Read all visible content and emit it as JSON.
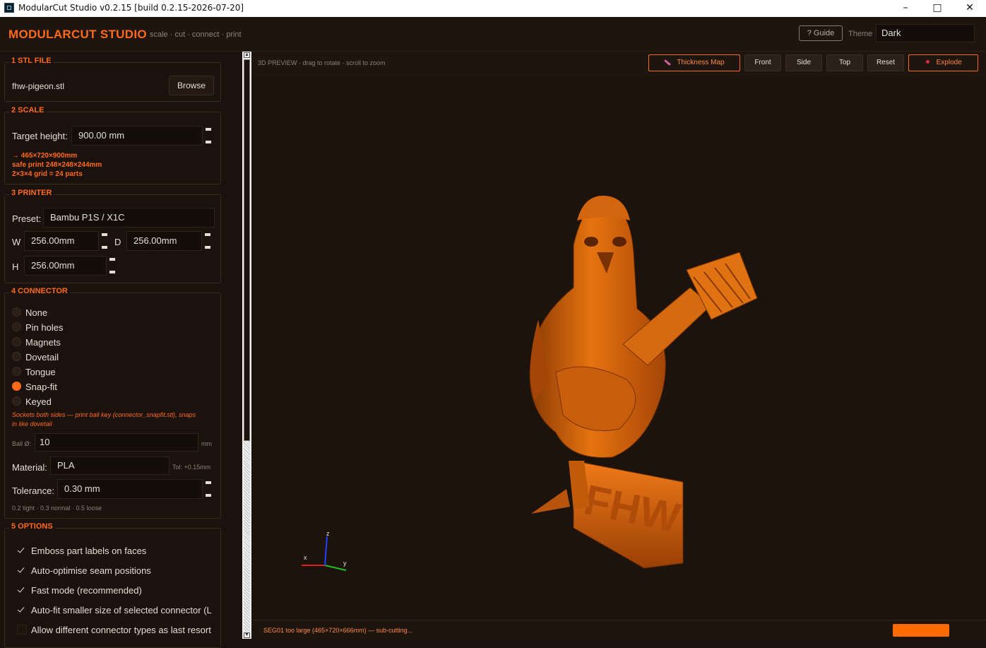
{
  "window": {
    "title": "ModularCut Studio  v0.2.15  [build 0.2.15-2026-07-20]",
    "minimize": "–",
    "maximize": "□",
    "close": "✕"
  },
  "header": {
    "brand": "MODULARCUT STUDIO",
    "tagline": "scale · cut · connect · print",
    "guide": "? Guide",
    "theme_label": "Theme",
    "theme_value": "Dark"
  },
  "stl": {
    "title": "1  STL FILE",
    "filename": "fhw-pigeon.stl",
    "browse": "Browse"
  },
  "scale": {
    "title": "2  SCALE",
    "target_label": "Target height:",
    "target_value": "900.00 mm",
    "info1": "→ 465×720×900mm",
    "info2": "safe print 248×248×244mm",
    "info3": "2×3×4 grid = 24 parts"
  },
  "printer": {
    "title": "3  PRINTER",
    "preset_label": "Preset:",
    "preset_value": "Bambu P1S / X1C",
    "w_label": "W",
    "w_value": "256.00mm",
    "d_label": "D",
    "d_value": "256.00mm",
    "h_label": "H",
    "h_value": "256.00mm"
  },
  "connector": {
    "title": "4  CONNECTOR",
    "options": [
      "None",
      "Pin holes",
      "Magnets",
      "Dovetail",
      "Tongue",
      "Snap-fit",
      "Keyed"
    ],
    "selected": "Snap-fit",
    "desc1": "Sockets both sides — print ball key (connector_snapfit.stl), snaps",
    "desc2": "in like dovetail",
    "ball_label": "Ball Ø:",
    "ball_value": "10",
    "ball_unit": "mm",
    "material_label": "Material:",
    "material_value": "PLA",
    "tol_hint": "Tol: +0.15mm",
    "tolerance_label": "Tolerance:",
    "tolerance_value": "0.30 mm",
    "tolerance_hint": "0.2 tight · 0.3 normal · 0.5 loose"
  },
  "options": {
    "title": "5  OPTIONS",
    "items": [
      {
        "label": "Emboss part labels on faces",
        "checked": true
      },
      {
        "label": "Auto-optimise seam positions",
        "checked": true
      },
      {
        "label": "Fast mode (recommended)",
        "checked": true
      },
      {
        "label": "Auto-fit smaller size of selected connector (L",
        "checked": true
      },
      {
        "label": "Allow different connector types as last resort",
        "checked": false
      }
    ]
  },
  "preview": {
    "label": "3D PREVIEW  ·  drag to rotate  ·  scroll to zoom",
    "thickness": "Thickness Map",
    "front": "Front",
    "side": "Side",
    "top": "Top",
    "reset": "Reset",
    "explode": "Explode",
    "axis_x": "x",
    "axis_y": "y",
    "axis_z": "z",
    "model_text": "FHW",
    "model_color": "#e06a10"
  },
  "status": {
    "text": "SEG01 too large (465×720×666mm) — sub-cutting..."
  }
}
